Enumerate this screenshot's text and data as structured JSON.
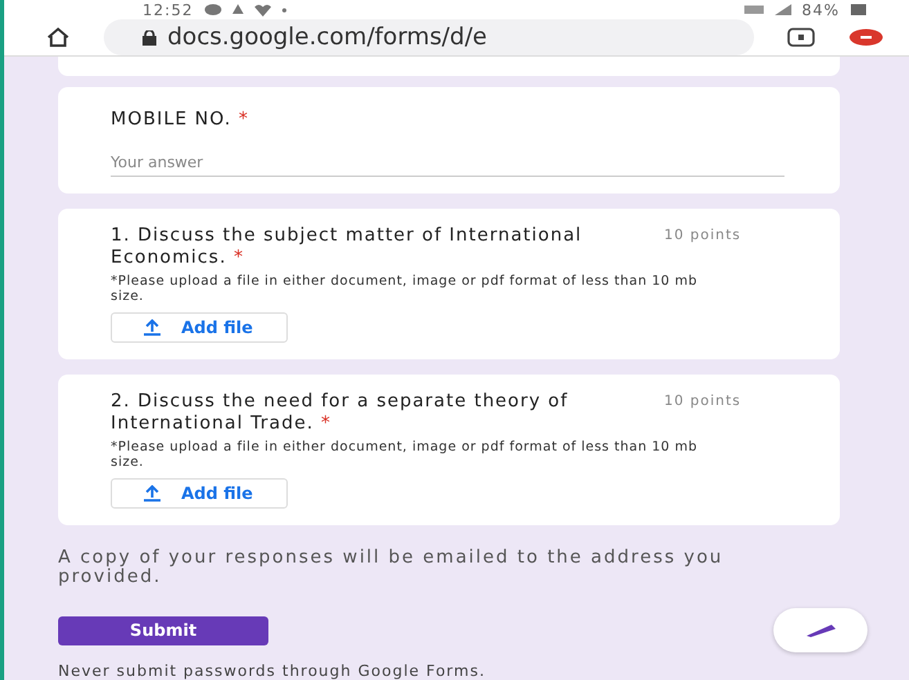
{
  "status_bar": {
    "time": "12:52",
    "battery": "84%"
  },
  "browser": {
    "url": "docs.google.com/forms/d/e"
  },
  "mobile_field": {
    "label": "MOBILE NO.",
    "required_mark": "*",
    "placeholder": "Your answer"
  },
  "questions": [
    {
      "title": "1. Discuss the subject matter of International Economics.",
      "required_mark": "*",
      "points": "10 points",
      "note": "*Please upload a file in either document, image or pdf format of less than 10 mb size.",
      "button": "Add file"
    },
    {
      "title": "2. Discuss the need for a separate theory of International Trade.",
      "required_mark": "*",
      "points": "10 points",
      "note": "*Please upload a file in either document, image or pdf format of less than 10 mb size.",
      "button": "Add file"
    }
  ],
  "confirmation": "A copy of your responses will be emailed to the address you provided.",
  "submit": "Submit",
  "footer": "Never submit passwords through Google Forms."
}
